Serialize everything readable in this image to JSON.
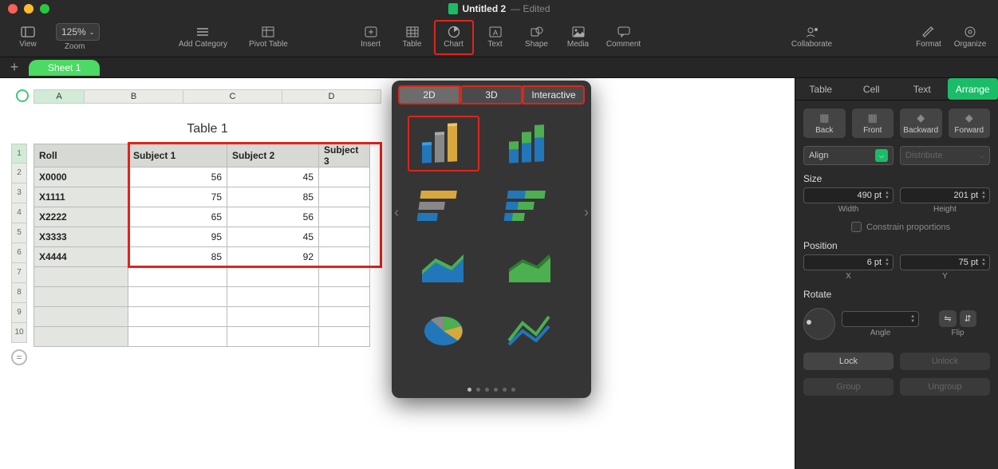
{
  "titlebar": {
    "docname": "Untitled 2",
    "status": "— Edited"
  },
  "toolbar": {
    "view": "View",
    "zoom_label": "Zoom",
    "zoom_value": "125%",
    "add_category": "Add Category",
    "pivot_table": "Pivot Table",
    "insert": "Insert",
    "table": "Table",
    "chart": "Chart",
    "text": "Text",
    "shape": "Shape",
    "media": "Media",
    "comment": "Comment",
    "collaborate": "Collaborate",
    "format": "Format",
    "organize": "Organize"
  },
  "sheets": {
    "sheet1": "Sheet 1"
  },
  "spreadsheet": {
    "columns": {
      "A": "A",
      "B": "B",
      "C": "C",
      "D": "D"
    },
    "rows": [
      "1",
      "2",
      "3",
      "4",
      "5",
      "6",
      "7",
      "8",
      "9",
      "10"
    ],
    "table_title": "Table 1",
    "headers": {
      "roll": "Roll",
      "s1": "Subject 1",
      "s2": "Subject 2",
      "s3": "Subject 3"
    },
    "data": [
      {
        "roll": "X0000",
        "s1": "56",
        "s2": "45",
        "s3": ""
      },
      {
        "roll": "X1111",
        "s1": "75",
        "s2": "85",
        "s3": ""
      },
      {
        "roll": "X2222",
        "s1": "65",
        "s2": "56",
        "s3": ""
      },
      {
        "roll": "X3333",
        "s1": "95",
        "s2": "45",
        "s3": ""
      },
      {
        "roll": "X4444",
        "s1": "85",
        "s2": "92",
        "s3": ""
      }
    ]
  },
  "popover": {
    "tab_2d": "2D",
    "tab_3d": "3D",
    "tab_int": "Interactive"
  },
  "inspector": {
    "tabs": {
      "table": "Table",
      "cell": "Cell",
      "text": "Text",
      "arrange": "Arrange"
    },
    "back": "Back",
    "front": "Front",
    "backward": "Backward",
    "forward": "Forward",
    "align": "Align",
    "distribute": "Distribute",
    "size": "Size",
    "width_val": "490 pt",
    "width_lbl": "Width",
    "height_val": "201 pt",
    "height_lbl": "Height",
    "constrain": "Constrain proportions",
    "position": "Position",
    "x_val": "6 pt",
    "x_lbl": "X",
    "y_val": "75 pt",
    "y_lbl": "Y",
    "rotate": "Rotate",
    "angle": "Angle",
    "flip": "Flip",
    "lock": "Lock",
    "unlock": "Unlock",
    "group": "Group",
    "ungroup": "Ungroup"
  }
}
